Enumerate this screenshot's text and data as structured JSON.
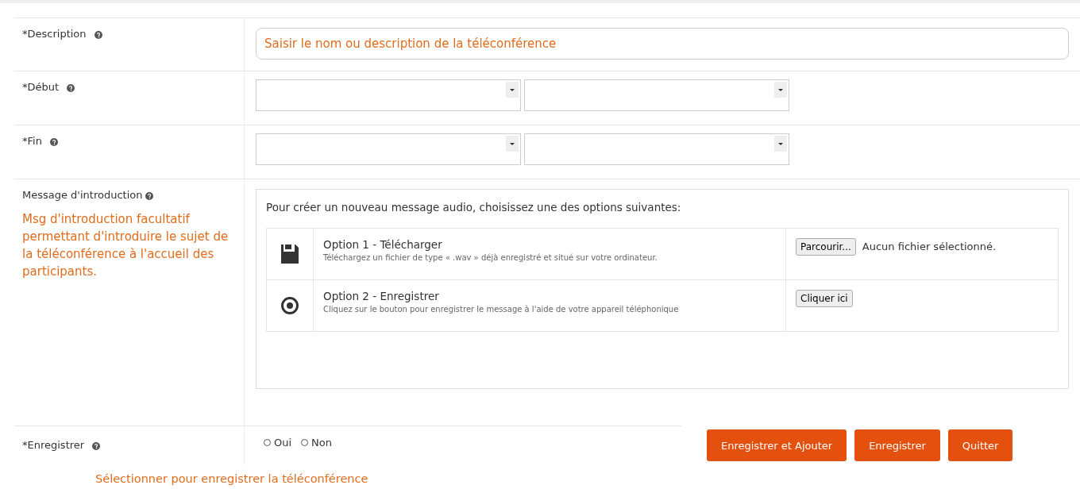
{
  "description": {
    "label": "*Description",
    "placeholder": "Saisir le nom ou description de la téléconférence"
  },
  "debut": {
    "label": "*Début"
  },
  "fin": {
    "label": "*Fin"
  },
  "intro": {
    "label": "Message d'introduction",
    "note": "Msg d'introduction facultatif permettant d'introduire le sujet de la téléconférence à l'accueil des participants.",
    "heading": "Pour créer un nouveau message audio, choisissez une des options suivantes:",
    "options": [
      {
        "kind": "upload",
        "title": "Option 1 - Télécharger",
        "text": "Téléchargez un fichier de type « .wav » déjà enregistré et situé sur votre ordinateur.",
        "button": "Parcourir...",
        "status": "Aucun fichier sélectionné."
      },
      {
        "kind": "record",
        "title": "Option 2 - Enregistrer",
        "text": "Cliquez sur le bouton pour enregistrer le message à l'aide de votre appareil téléphonique",
        "button": "Cliquer ici"
      }
    ]
  },
  "record": {
    "label": "*Enregistrer",
    "radios": [
      {
        "label": "Oui",
        "selected": false
      },
      {
        "label": "Non",
        "selected": false
      }
    ],
    "note": "Sélectionner pour enregistrer la téléconférence"
  },
  "buttons": [
    "Enregistrer et Ajouter",
    "Enregistrer",
    "Quitter"
  ]
}
